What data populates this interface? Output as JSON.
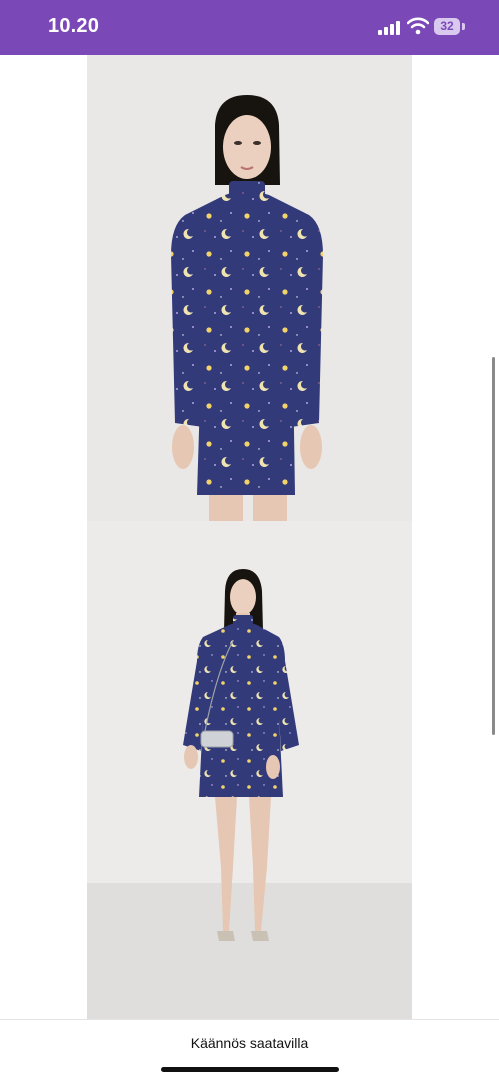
{
  "status_bar": {
    "time": "10.20",
    "battery_level": "32",
    "icons": [
      "cellular-signal-icon",
      "wifi-icon",
      "battery-icon"
    ],
    "background_color": "#7b48b8"
  },
  "product_images": [
    {
      "description": "model front upper body"
    },
    {
      "description": "model full length with handbag"
    }
  ],
  "bottom_bar": {
    "translation_label": "Käännös saatavilla"
  }
}
